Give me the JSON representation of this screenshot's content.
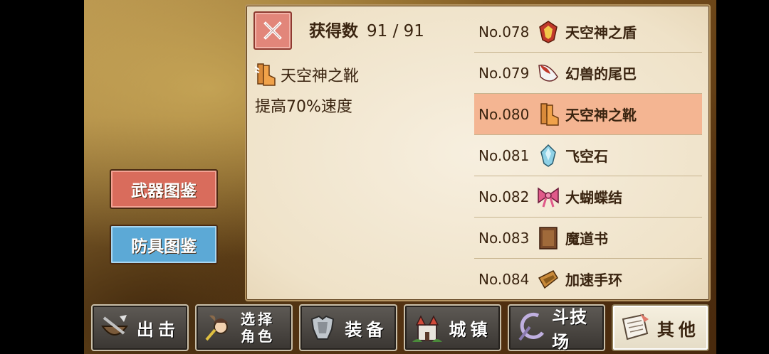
{
  "header": {
    "count_label": "获得数",
    "count_value": "91 / 91"
  },
  "detail": {
    "name": "天空神之靴",
    "description": "提高70%速度",
    "icon": "boots-icon"
  },
  "side": {
    "weapons_label": "武器图鉴",
    "armor_label": "防具图鉴"
  },
  "items": [
    {
      "no": "No.078",
      "name": "天空神之盾",
      "icon": "shield-icon",
      "selected": false
    },
    {
      "no": "No.079",
      "name": "幻兽的尾巴",
      "icon": "tail-icon",
      "selected": false
    },
    {
      "no": "No.080",
      "name": "天空神之靴",
      "icon": "boots-icon",
      "selected": true
    },
    {
      "no": "No.081",
      "name": "飞空石",
      "icon": "crystal-icon",
      "selected": false
    },
    {
      "no": "No.082",
      "name": "大蝴蝶结",
      "icon": "ribbon-icon",
      "selected": false
    },
    {
      "no": "No.083",
      "name": "魔道书",
      "icon": "book-icon",
      "selected": false
    },
    {
      "no": "No.084",
      "name": "加速手环",
      "icon": "bracelet-icon",
      "selected": false
    }
  ],
  "nav": [
    {
      "label": "出击",
      "icon": "sortie-icon"
    },
    {
      "label": "选择角色",
      "line1": "选择",
      "line2": "角色",
      "icon": "character-icon"
    },
    {
      "label": "装备",
      "icon": "armor-icon"
    },
    {
      "label": "城镇",
      "icon": "castle-icon"
    },
    {
      "label": "斗技场",
      "icon": "arena-icon"
    },
    {
      "label": "其他",
      "icon": "scroll-icon",
      "active": true
    }
  ],
  "colors": {
    "selected_row": "#f4b592",
    "close": "#e2867a",
    "weapons": "#d96c5c",
    "armor": "#5ca9d6"
  }
}
